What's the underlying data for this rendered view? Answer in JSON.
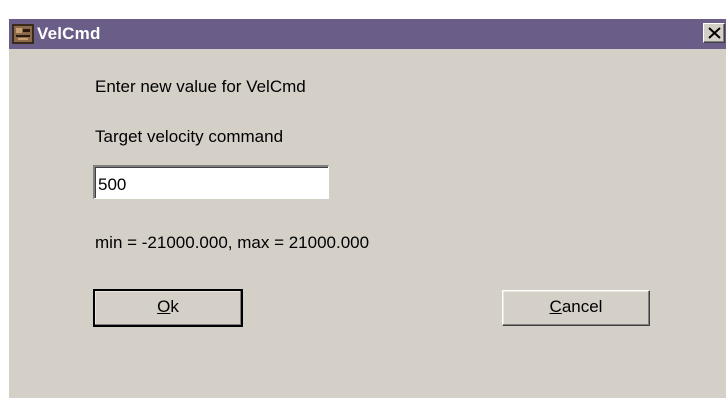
{
  "window": {
    "title": "VelCmd",
    "icon": "app-icon",
    "close_icon": "close-icon",
    "colors": {
      "titlebar": "#6a5d87",
      "face": "#d4d0c8"
    }
  },
  "dialog": {
    "prompt": "Enter new value for VelCmd",
    "field_label": "Target velocity command",
    "value": "500",
    "range_text": "min = -21000.000, max = 21000.000"
  },
  "buttons": {
    "ok": {
      "mnemonic": "O",
      "rest": "k"
    },
    "cancel": {
      "mnemonic": "C",
      "rest": "ancel"
    }
  }
}
